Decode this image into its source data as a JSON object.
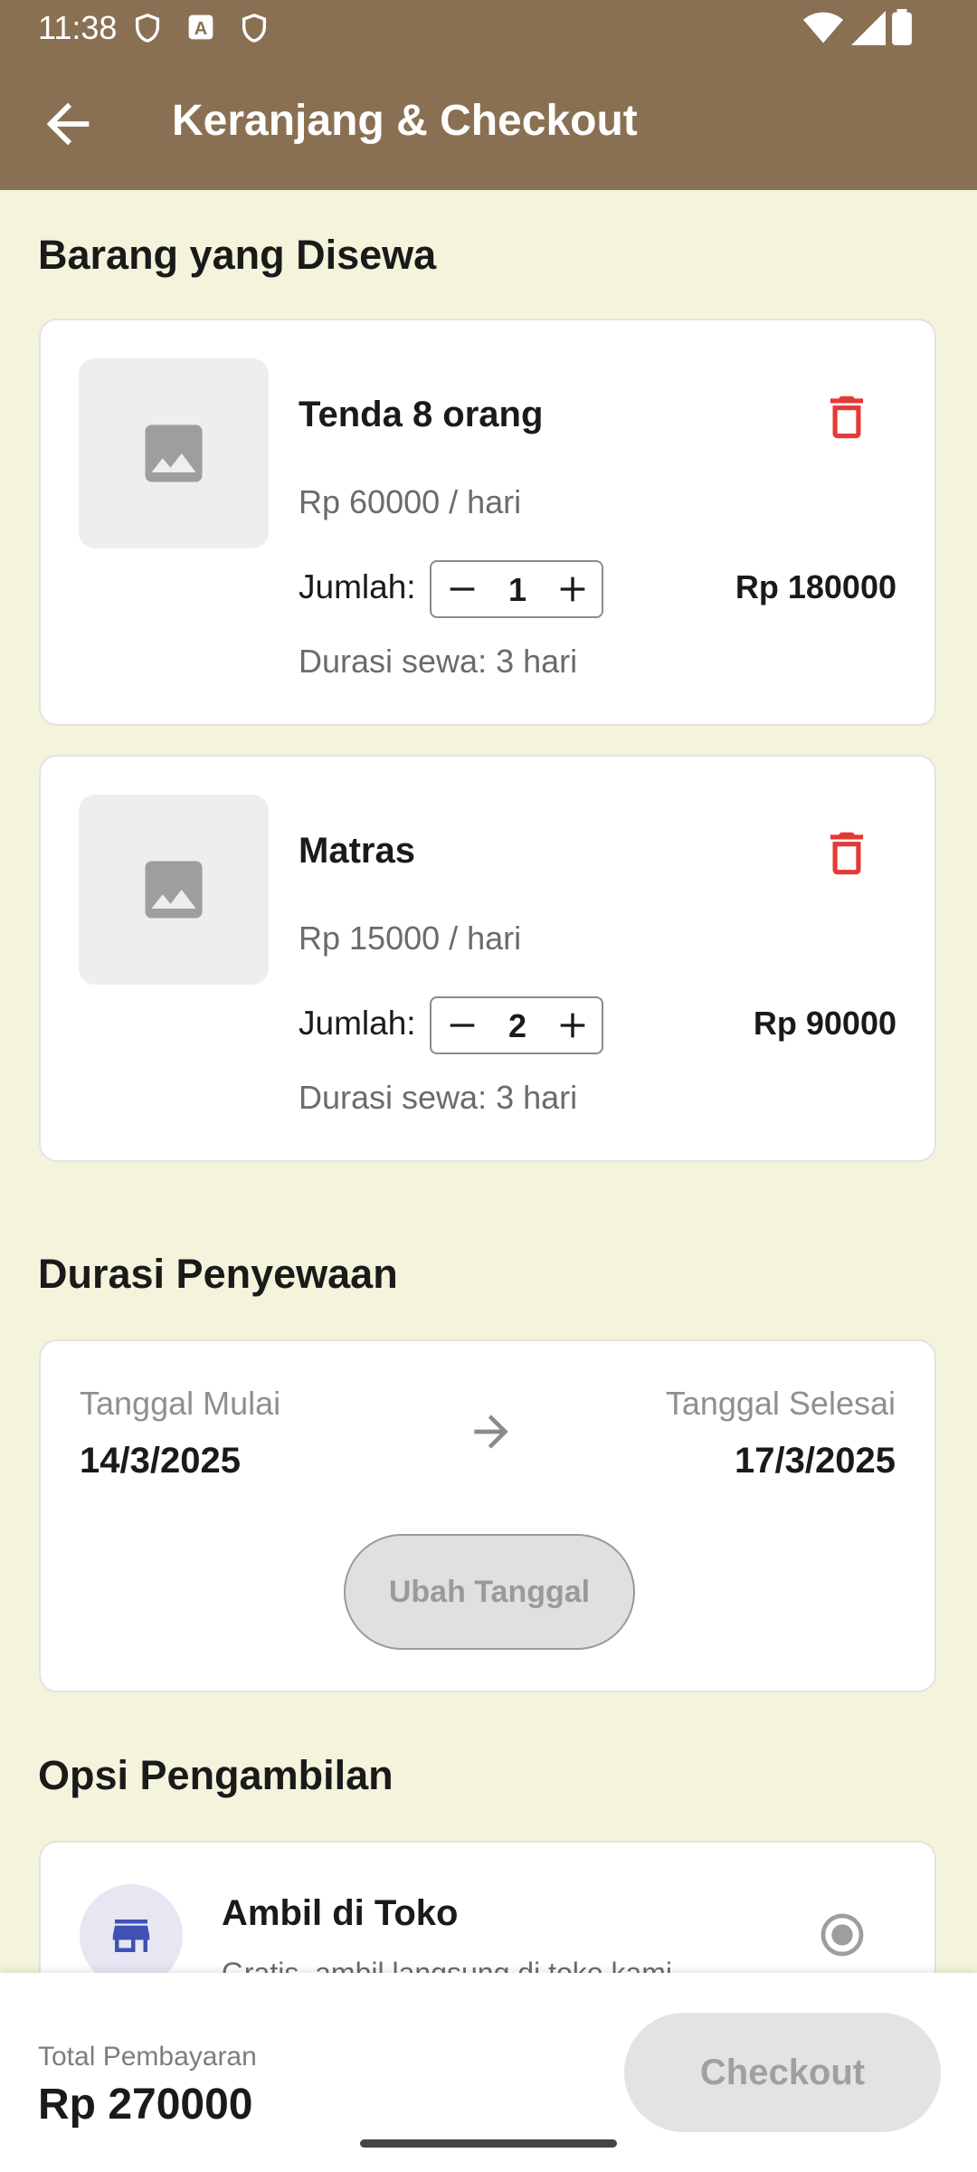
{
  "status_bar": {
    "time": "11:38"
  },
  "app_bar": {
    "title": "Keranjang & Checkout"
  },
  "sections": {
    "items_title": "Barang yang Disewa",
    "duration_title": "Durasi Penyewaan",
    "pickup_title": "Opsi Pengambilan"
  },
  "items": [
    {
      "name": "Tenda 8 orang",
      "price": "Rp 60000 / hari",
      "qty_label": "Jumlah:",
      "qty": "1",
      "subtotal": "Rp 180000",
      "duration": "Durasi sewa: 3 hari"
    },
    {
      "name": "Matras",
      "price": "Rp 15000 / hari",
      "qty_label": "Jumlah:",
      "qty": "2",
      "subtotal": "Rp 90000",
      "duration": "Durasi sewa: 3 hari"
    }
  ],
  "rental": {
    "start_label": "Tanggal Mulai",
    "start_value": "14/3/2025",
    "end_label": "Tanggal Selesai",
    "end_value": "17/3/2025",
    "change_button": "Ubah Tanggal"
  },
  "pickup": {
    "option_title": "Ambil di Toko",
    "option_desc": "Gratis, ambil langsung di toko kami",
    "selected": true
  },
  "footer": {
    "total_label": "Total Pembayaran",
    "total_value": "Rp 270000",
    "checkout_label": "Checkout"
  },
  "colors": {
    "app_bar": "#8a7052",
    "background": "#f4f3dc",
    "delete": "#e53935",
    "store_icon": "#3f51b5"
  }
}
